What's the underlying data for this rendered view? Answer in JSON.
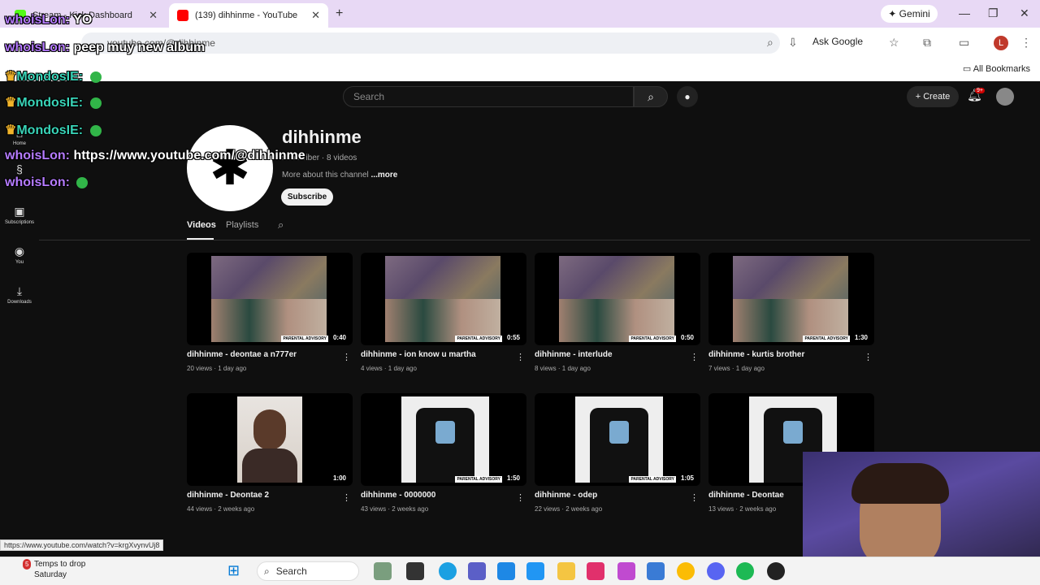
{
  "browser": {
    "tabs": [
      {
        "title": "Stream - Kick Dashboard",
        "favicon_color": "#53fc18"
      },
      {
        "title": "(139) dihhinme - YouTube",
        "favicon_color": "#ff0000"
      }
    ],
    "new_tab": "+",
    "close_glyph": "✕",
    "gemini_label": "✦ Gemini",
    "window_controls": [
      "—",
      "❐",
      "✕"
    ],
    "url": "youtube.com/@dihhinme",
    "ask_google": "Ask Google",
    "profile_letter": "L",
    "all_bookmarks": "All Bookmarks"
  },
  "youtube": {
    "search_placeholder": "Search",
    "create_label": "+ Create",
    "notification_badge": "9+",
    "sidebar": [
      {
        "label": "Home",
        "icon": "home-icon",
        "glyph": "⌂"
      },
      {
        "label": "Shorts",
        "icon": "shorts-icon",
        "glyph": "§"
      },
      {
        "label": "Subscriptions",
        "icon": "subscriptions-icon",
        "glyph": "▣"
      },
      {
        "label": "You",
        "icon": "you-icon",
        "glyph": "◉"
      },
      {
        "label": "Downloads",
        "icon": "download-icon",
        "glyph": "⤓"
      }
    ],
    "channel": {
      "name": "dihhinme",
      "meta": "subscriber · 8 videos",
      "more_prefix": "More about this channel",
      "more_link": "...more",
      "subscribe": "Subscribe",
      "avatar_glyph": "✱"
    },
    "tabs": [
      "Videos",
      "Playlists"
    ],
    "videos": [
      {
        "title": "dihhinme - deontae a n777er",
        "meta": "20 views · 1 day ago",
        "duration": "0:40",
        "art": "collage"
      },
      {
        "title": "dihhinme - ion know u martha",
        "meta": "4 views · 1 day ago",
        "duration": "0:55",
        "art": "collage"
      },
      {
        "title": "dihhinme - interlude",
        "meta": "8 views · 1 day ago",
        "duration": "0:50",
        "art": "collage"
      },
      {
        "title": "dihhinme - kurtis brother",
        "meta": "7 views · 1 day ago",
        "duration": "1:30",
        "art": "collage"
      },
      {
        "title": "dihhinme - Deontae 2",
        "meta": "44 views · 2 weeks ago",
        "duration": "1:00",
        "art": "portrait"
      },
      {
        "title": "dihhinme - 0000000",
        "meta": "43 views · 2 weeks ago",
        "duration": "1:50",
        "art": "shirt"
      },
      {
        "title": "dihhinme - odep",
        "meta": "22 views · 2 weeks ago",
        "duration": "1:05",
        "art": "shirt"
      },
      {
        "title": "dihhinme - Deontae",
        "meta": "13 views · 2 weeks ago",
        "duration": "",
        "art": "shirt"
      }
    ],
    "parental_label": "PARENTAL ADVISORY"
  },
  "chat": [
    {
      "name": "whoisLon:",
      "message": "YO",
      "color": "purple"
    },
    {
      "name": "whoisLon:",
      "message": "peep muy new album",
      "color": "purple"
    },
    {
      "name": "MondosIE:",
      "message": "",
      "color": "teal",
      "crown": true,
      "emote": true
    },
    {
      "name": "MondosIE:",
      "message": "",
      "color": "teal",
      "crown": true,
      "emote": true
    },
    {
      "name": "MondosIE:",
      "message": "",
      "color": "teal",
      "crown": true,
      "emote": true
    },
    {
      "name": "whoisLon:",
      "message": "https://www.youtube.com/@dihhinme",
      "color": "purple"
    },
    {
      "name": "whoisLon:",
      "message": "",
      "color": "purple",
      "emote": true
    }
  ],
  "status_url": "https://www.youtube.com/watch?v=krgXvynvUj8",
  "taskbar": {
    "weather_title": "Temps to drop",
    "weather_sub": "Saturday",
    "weather_badge": "5",
    "search": "Search"
  }
}
